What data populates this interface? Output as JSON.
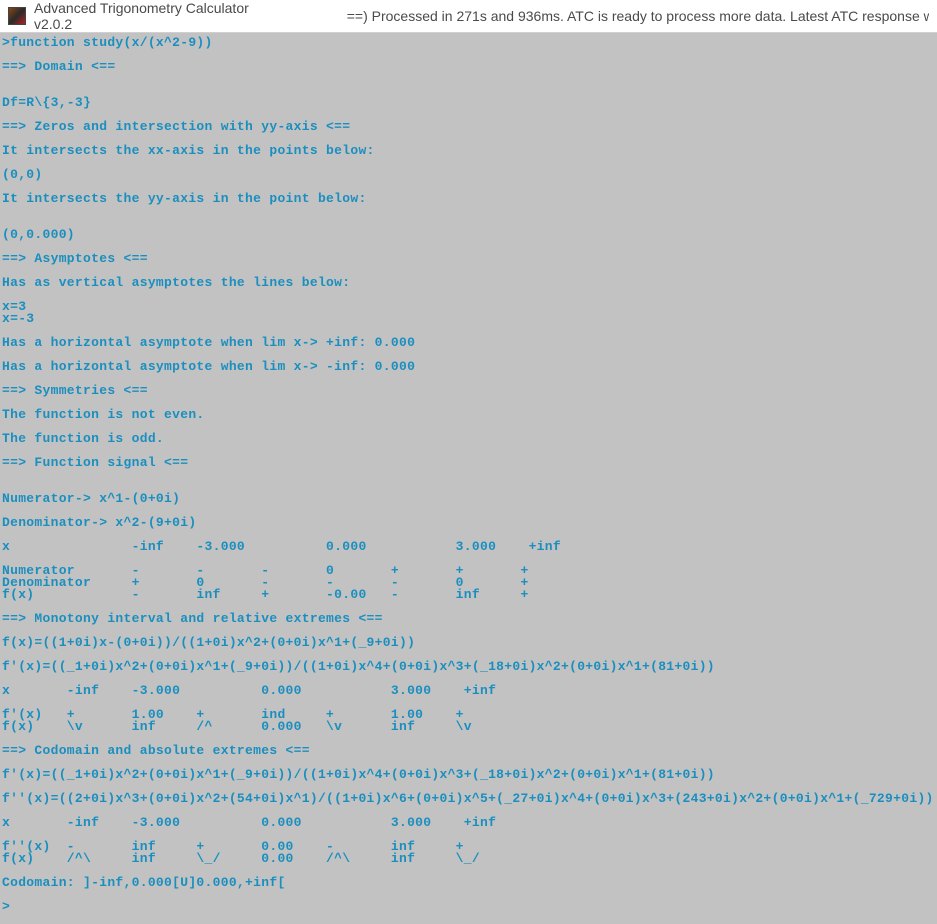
{
  "titlebar": {
    "app_title": "Advanced Trigonometry Calculator v2.0.2",
    "status": "==) Processed in 271s and 936ms. ATC is ready to process more data. Latest ATC response w"
  },
  "terminal": {
    "lines": [
      ">function study(x/(x^2-9))",
      "",
      "==> Domain <==",
      "",
      "",
      "Df=R\\{3,-3}",
      "",
      "==> Zeros and intersection with yy-axis <==",
      "",
      "It intersects the xx-axis in the points below:",
      "",
      "(0,0)",
      "",
      "It intersects the yy-axis in the point below:",
      "",
      "",
      "(0,0.000)",
      "",
      "==> Asymptotes <==",
      "",
      "Has as vertical asymptotes the lines below:",
      "",
      "x=3",
      "x=-3",
      "",
      "Has a horizontal asymptote when lim x-> +inf: 0.000",
      "",
      "Has a horizontal asymptote when lim x-> -inf: 0.000",
      "",
      "==> Symmetries <==",
      "",
      "The function is not even.",
      "",
      "The function is odd.",
      "",
      "==> Function signal <==",
      "",
      "",
      "Numerator-> x^1-(0+0i)",
      "",
      "Denominator-> x^2-(9+0i)",
      "",
      "x               -inf    -3.000          0.000           3.000    +inf",
      "",
      "Numerator       -       -       -       0       +       +       +",
      "Denominator     +       0       -       -       -       0       +",
      "f(x)            -       inf     +       -0.00   -       inf     +",
      "",
      "==> Monotony interval and relative extremes <==",
      "",
      "f(x)=((1+0i)x-(0+0i))/((1+0i)x^2+(0+0i)x^1+(_9+0i))",
      "",
      "f'(x)=((_1+0i)x^2+(0+0i)x^1+(_9+0i))/((1+0i)x^4+(0+0i)x^3+(_18+0i)x^2+(0+0i)x^1+(81+0i))",
      "",
      "x       -inf    -3.000          0.000           3.000    +inf",
      "",
      "f'(x)   +       1.00    +       ind     +       1.00    +",
      "f(x)    \\v      inf     /^      0.000   \\v      inf     \\v",
      "",
      "==> Codomain and absolute extremes <==",
      "",
      "f'(x)=((_1+0i)x^2+(0+0i)x^1+(_9+0i))/((1+0i)x^4+(0+0i)x^3+(_18+0i)x^2+(0+0i)x^1+(81+0i))",
      "",
      "f''(x)=((2+0i)x^3+(0+0i)x^2+(54+0i)x^1)/((1+0i)x^6+(0+0i)x^5+(_27+0i)x^4+(0+0i)x^3+(243+0i)x^2+(0+0i)x^1+(_729+0i))",
      "",
      "x       -inf    -3.000          0.000           3.000    +inf",
      "",
      "f''(x)  -       inf     +       0.00    -       inf     +",
      "f(x)    /^\\     inf     \\_/     0.00    /^\\     inf     \\_/",
      "",
      "Codomain: ]-inf,0.000[U]0.000,+inf[",
      "",
      ">"
    ]
  }
}
